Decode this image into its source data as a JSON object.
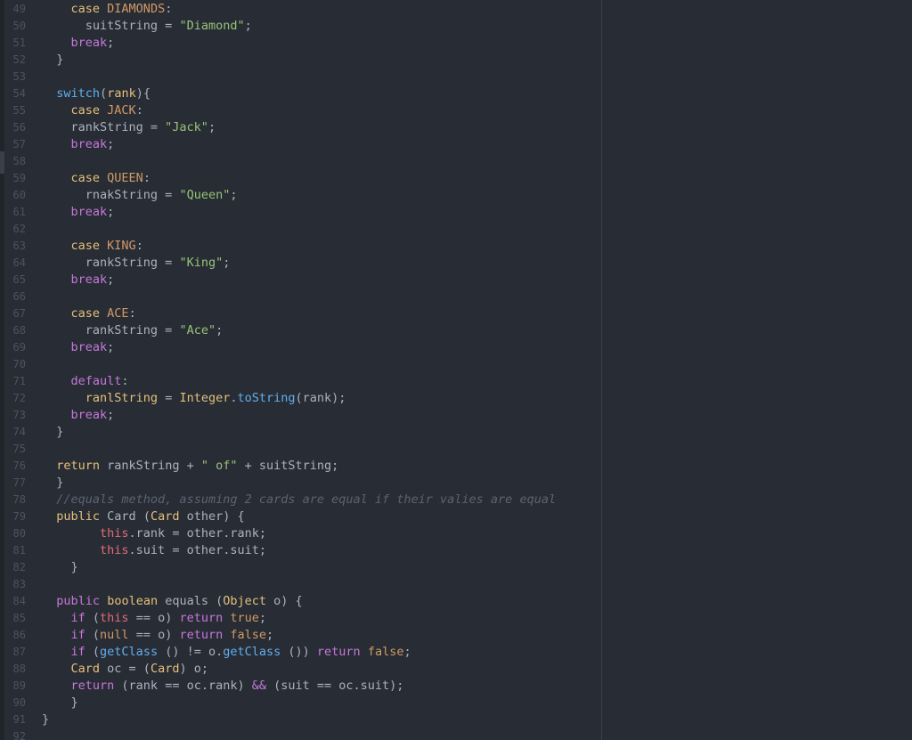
{
  "editor": {
    "lines": [
      {
        "num": "49",
        "tokens": [
          {
            "t": "    "
          },
          {
            "t": "case",
            "c": "kc"
          },
          {
            "t": " "
          },
          {
            "t": "DIAMONDS",
            "c": "c"
          },
          {
            "t": ":"
          }
        ]
      },
      {
        "num": "50",
        "tokens": [
          {
            "t": "      suitString "
          },
          {
            "t": "="
          },
          {
            "t": " "
          },
          {
            "t": "\"Diamond\"",
            "c": "s"
          },
          {
            "t": ";"
          }
        ]
      },
      {
        "num": "51",
        "tokens": [
          {
            "t": "    "
          },
          {
            "t": "break",
            "c": "k"
          },
          {
            "t": ";"
          }
        ]
      },
      {
        "num": "52",
        "tokens": [
          {
            "t": "  }"
          }
        ]
      },
      {
        "num": "53",
        "tokens": []
      },
      {
        "num": "54",
        "tokens": [
          {
            "t": "  "
          },
          {
            "t": "switch",
            "c": "f"
          },
          {
            "t": "("
          },
          {
            "t": "rank",
            "c": "t"
          },
          {
            "t": "){"
          }
        ]
      },
      {
        "num": "55",
        "tokens": [
          {
            "t": "    "
          },
          {
            "t": "case",
            "c": "kc"
          },
          {
            "t": " "
          },
          {
            "t": "JACK",
            "c": "c"
          },
          {
            "t": ":"
          }
        ]
      },
      {
        "num": "56",
        "tokens": [
          {
            "t": "    rankString = "
          },
          {
            "t": "\"Jack\"",
            "c": "s"
          },
          {
            "t": ";"
          }
        ]
      },
      {
        "num": "57",
        "tokens": [
          {
            "t": "    "
          },
          {
            "t": "break",
            "c": "k"
          },
          {
            "t": ";"
          }
        ]
      },
      {
        "num": "58",
        "tokens": []
      },
      {
        "num": "59",
        "tokens": [
          {
            "t": "    "
          },
          {
            "t": "case",
            "c": "kc"
          },
          {
            "t": " "
          },
          {
            "t": "QUEEN",
            "c": "c"
          },
          {
            "t": ":"
          }
        ]
      },
      {
        "num": "60",
        "tokens": [
          {
            "t": "      rnakString = "
          },
          {
            "t": "\"Queen\"",
            "c": "s"
          },
          {
            "t": ";"
          }
        ]
      },
      {
        "num": "61",
        "tokens": [
          {
            "t": "    "
          },
          {
            "t": "break",
            "c": "k"
          },
          {
            "t": ";"
          }
        ]
      },
      {
        "num": "62",
        "tokens": []
      },
      {
        "num": "63",
        "tokens": [
          {
            "t": "    "
          },
          {
            "t": "case",
            "c": "kc"
          },
          {
            "t": " "
          },
          {
            "t": "KING",
            "c": "c"
          },
          {
            "t": ":"
          }
        ]
      },
      {
        "num": "64",
        "tokens": [
          {
            "t": "      rankString = "
          },
          {
            "t": "\"King\"",
            "c": "s"
          },
          {
            "t": ";"
          }
        ]
      },
      {
        "num": "65",
        "tokens": [
          {
            "t": "    "
          },
          {
            "t": "break",
            "c": "k"
          },
          {
            "t": ";"
          }
        ]
      },
      {
        "num": "66",
        "tokens": []
      },
      {
        "num": "67",
        "tokens": [
          {
            "t": "    "
          },
          {
            "t": "case",
            "c": "kc"
          },
          {
            "t": " "
          },
          {
            "t": "ACE",
            "c": "c"
          },
          {
            "t": ":"
          }
        ]
      },
      {
        "num": "68",
        "tokens": [
          {
            "t": "      rankString = "
          },
          {
            "t": "\"Ace\"",
            "c": "s"
          },
          {
            "t": ";"
          }
        ]
      },
      {
        "num": "69",
        "tokens": [
          {
            "t": "    "
          },
          {
            "t": "break",
            "c": "k"
          },
          {
            "t": ";"
          }
        ]
      },
      {
        "num": "70",
        "tokens": []
      },
      {
        "num": "71",
        "tokens": [
          {
            "t": "    "
          },
          {
            "t": "default",
            "c": "k"
          },
          {
            "t": ":"
          }
        ]
      },
      {
        "num": "72",
        "tokens": [
          {
            "t": "      "
          },
          {
            "t": "ranlString",
            "c": "t"
          },
          {
            "t": " = "
          },
          {
            "t": "Integer",
            "c": "t"
          },
          {
            "t": "."
          },
          {
            "t": "toString",
            "c": "f"
          },
          {
            "t": "(rank);"
          }
        ]
      },
      {
        "num": "73",
        "tokens": [
          {
            "t": "    "
          },
          {
            "t": "break",
            "c": "k"
          },
          {
            "t": ";"
          }
        ]
      },
      {
        "num": "74",
        "tokens": [
          {
            "t": "  }"
          }
        ]
      },
      {
        "num": "75",
        "tokens": []
      },
      {
        "num": "76",
        "tokens": [
          {
            "t": "  "
          },
          {
            "t": "return",
            "c": "kc"
          },
          {
            "t": " rankString + "
          },
          {
            "t": "\" of\"",
            "c": "s"
          },
          {
            "t": " + suitString;"
          }
        ]
      },
      {
        "num": "77",
        "tokens": [
          {
            "t": "  }"
          }
        ]
      },
      {
        "num": "78",
        "tokens": [
          {
            "t": "  "
          },
          {
            "t": "//equals method, assuming 2 cards are equal if their valies are equal",
            "c": "cm"
          }
        ]
      },
      {
        "num": "79",
        "tokens": [
          {
            "t": "  "
          },
          {
            "t": "public",
            "c": "kc"
          },
          {
            "t": " Card ("
          },
          {
            "t": "Card",
            "c": "t"
          },
          {
            "t": " other) {"
          }
        ]
      },
      {
        "num": "80",
        "tokens": [
          {
            "t": "        "
          },
          {
            "t": "this",
            "c": "th"
          },
          {
            "t": ".rank = other.rank;"
          }
        ]
      },
      {
        "num": "81",
        "tokens": [
          {
            "t": "        "
          },
          {
            "t": "this",
            "c": "th"
          },
          {
            "t": ".suit = other.suit;"
          }
        ]
      },
      {
        "num": "82",
        "tokens": [
          {
            "t": "    }"
          }
        ]
      },
      {
        "num": "83",
        "tokens": []
      },
      {
        "num": "84",
        "tokens": [
          {
            "t": "  "
          },
          {
            "t": "public",
            "c": "k"
          },
          {
            "t": " "
          },
          {
            "t": "boolean",
            "c": "kc"
          },
          {
            "t": " equals ("
          },
          {
            "t": "Object",
            "c": "t"
          },
          {
            "t": " o) {"
          }
        ]
      },
      {
        "num": "85",
        "tokens": [
          {
            "t": "    "
          },
          {
            "t": "if",
            "c": "k"
          },
          {
            "t": " ("
          },
          {
            "t": "this",
            "c": "th"
          },
          {
            "t": " == o) "
          },
          {
            "t": "return",
            "c": "k"
          },
          {
            "t": " "
          },
          {
            "t": "true",
            "c": "c"
          },
          {
            "t": ";"
          }
        ]
      },
      {
        "num": "86",
        "tokens": [
          {
            "t": "    "
          },
          {
            "t": "if",
            "c": "k"
          },
          {
            "t": " ("
          },
          {
            "t": "null",
            "c": "c"
          },
          {
            "t": " == o) "
          },
          {
            "t": "return",
            "c": "k"
          },
          {
            "t": " "
          },
          {
            "t": "false",
            "c": "c"
          },
          {
            "t": ";"
          }
        ]
      },
      {
        "num": "87",
        "tokens": [
          {
            "t": "    "
          },
          {
            "t": "if",
            "c": "k"
          },
          {
            "t": " ("
          },
          {
            "t": "getClass",
            "c": "f"
          },
          {
            "t": " () != o."
          },
          {
            "t": "getClass",
            "c": "f"
          },
          {
            "t": " ()) "
          },
          {
            "t": "return",
            "c": "k"
          },
          {
            "t": " "
          },
          {
            "t": "false",
            "c": "c"
          },
          {
            "t": ";"
          }
        ]
      },
      {
        "num": "88",
        "tokens": [
          {
            "t": "    "
          },
          {
            "t": "Card",
            "c": "t"
          },
          {
            "t": " oc = ("
          },
          {
            "t": "Card",
            "c": "t"
          },
          {
            "t": ") o;"
          }
        ]
      },
      {
        "num": "89",
        "tokens": [
          {
            "t": "    "
          },
          {
            "t": "return",
            "c": "k"
          },
          {
            "t": " (rank == oc.rank) "
          },
          {
            "t": "&&",
            "c": "k"
          },
          {
            "t": " (suit == oc.suit);"
          }
        ]
      },
      {
        "num": "90",
        "tokens": [
          {
            "t": "    }"
          }
        ]
      },
      {
        "num": "91",
        "tokens": [
          {
            "t": "}"
          }
        ]
      },
      {
        "num": "92",
        "tokens": []
      }
    ]
  }
}
